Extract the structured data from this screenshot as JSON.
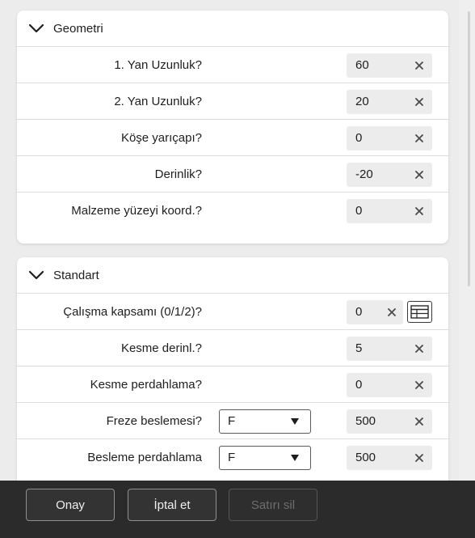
{
  "sections": {
    "geometri": {
      "title": "Geometri",
      "rows": [
        {
          "label": "1. Yan Uzunluk?",
          "value": "60"
        },
        {
          "label": "2. Yan Uzunluk?",
          "value": "20"
        },
        {
          "label": "Köşe yarıçapı?",
          "value": "0"
        },
        {
          "label": "Derinlik?",
          "value": "-20"
        },
        {
          "label": "Malzeme yüzeyi koord.?",
          "value": "0"
        }
      ]
    },
    "standart": {
      "title": "Standart",
      "rows": [
        {
          "label": "Çalışma kapsamı (0/1/2)?",
          "value": "0",
          "icon": "table-icon"
        },
        {
          "label": "Kesme derinl.?",
          "value": "5"
        },
        {
          "label": "Kesme perdahlama?",
          "value": "0"
        },
        {
          "label": "Freze beslemesi?",
          "value": "500",
          "select": "F"
        },
        {
          "label": "Besleme perdahlama",
          "value": "500",
          "select": "F"
        }
      ]
    }
  },
  "footer": {
    "confirm_label": "Onay",
    "cancel_label": "İptal et",
    "delete_row_label": "Satırı sil"
  },
  "icons": {
    "collapse": "chevron-down-icon",
    "clear": "close-icon",
    "dropdown": "caret-down-icon"
  },
  "colors": {
    "background": "#ececec",
    "panel": "#ffffff",
    "input_bg": "#ececec",
    "footer_bg": "#2b2b2b",
    "disabled_text": "#6e6e6e"
  }
}
